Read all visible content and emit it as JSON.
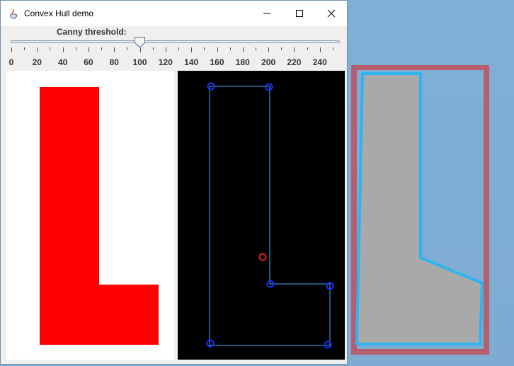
{
  "window": {
    "title": "Convex Hull demo",
    "app_icon": "java-coffee-icon",
    "controls": [
      "minimize-icon",
      "maximize-icon",
      "close-icon"
    ]
  },
  "slider": {
    "label": "Canny threshold:",
    "min": 0,
    "max": 255,
    "value": 100,
    "tick_labels": [
      "0",
      "20",
      "40",
      "60",
      "80",
      "100",
      "120",
      "140",
      "160",
      "180",
      "200",
      "220",
      "240"
    ]
  },
  "colors": {
    "shape_fill": "#ff0000",
    "hull_line": "#3ab0ff",
    "vertex_marker": "#1a2fff",
    "center_marker": "#e02020",
    "overlay_border": "#c0505a",
    "overlay_fill": "#a9a9a9",
    "overlay_outline": "#2eb4f0"
  }
}
